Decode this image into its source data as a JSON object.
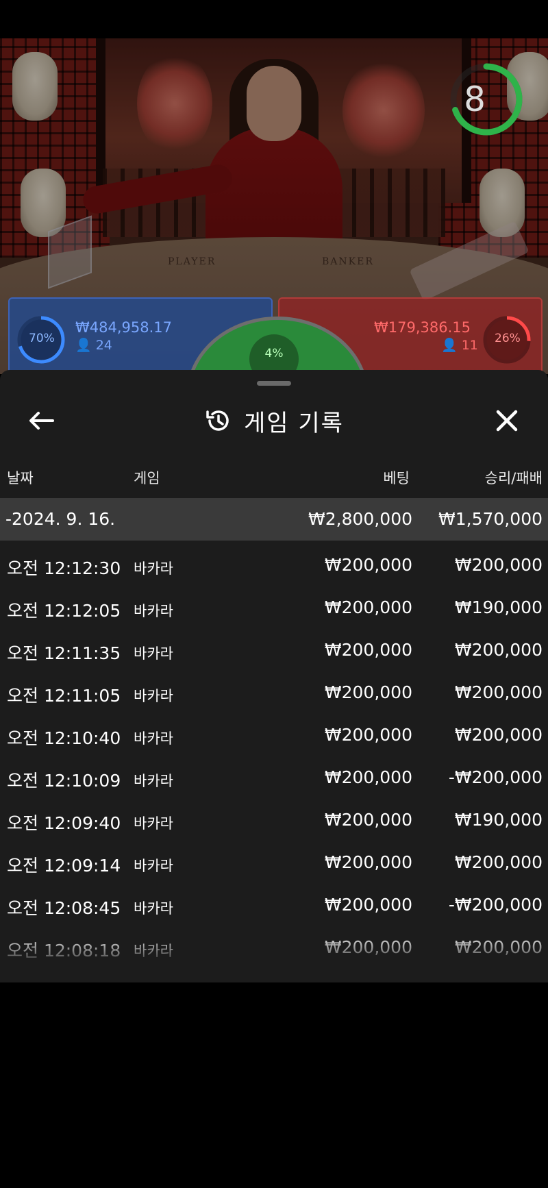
{
  "video": {
    "timer_value": "8",
    "table_labels": {
      "player": "PLAYER",
      "banker": "BANKER"
    }
  },
  "betting": {
    "player": {
      "percent": "70%",
      "amount": "₩484,958.17",
      "players": "24",
      "color": "#3a6ad0"
    },
    "tie": {
      "percent": "4%",
      "color": "#2a8a3a"
    },
    "banker": {
      "percent": "26%",
      "amount": "₩179,386.15",
      "players": "11",
      "color": "#c23a3a"
    }
  },
  "history": {
    "title": "게임 기록",
    "back_icon": "arrow-left-icon",
    "history_icon": "history-clock-icon",
    "close_icon": "close-icon",
    "columns": {
      "date": "날짜",
      "game": "게임",
      "bet": "베팅",
      "result": "승리/패배"
    },
    "group": {
      "label": "-2024. 9. 16.",
      "bet_total": "₩2,800,000",
      "result_total": "₩1,570,000"
    },
    "rows": [
      {
        "time": "오전 12:12:30",
        "game": "바카라",
        "bet": "₩200,000",
        "result": "₩200,000"
      },
      {
        "time": "오전 12:12:05",
        "game": "바카라",
        "bet": "₩200,000",
        "result": "₩190,000"
      },
      {
        "time": "오전 12:11:35",
        "game": "바카라",
        "bet": "₩200,000",
        "result": "₩200,000"
      },
      {
        "time": "오전 12:11:05",
        "game": "바카라",
        "bet": "₩200,000",
        "result": "₩200,000"
      },
      {
        "time": "오전 12:10:40",
        "game": "바카라",
        "bet": "₩200,000",
        "result": "₩200,000"
      },
      {
        "time": "오전 12:10:09",
        "game": "바카라",
        "bet": "₩200,000",
        "result": "-₩200,000"
      },
      {
        "time": "오전 12:09:40",
        "game": "바카라",
        "bet": "₩200,000",
        "result": "₩190,000"
      },
      {
        "time": "오전 12:09:14",
        "game": "바카라",
        "bet": "₩200,000",
        "result": "₩200,000"
      },
      {
        "time": "오전 12:08:45",
        "game": "바카라",
        "bet": "₩200,000",
        "result": "-₩200,000"
      },
      {
        "time": "오전 12:08:18",
        "game": "바카라",
        "bet": "₩200,000",
        "result": "₩200,000"
      }
    ]
  }
}
